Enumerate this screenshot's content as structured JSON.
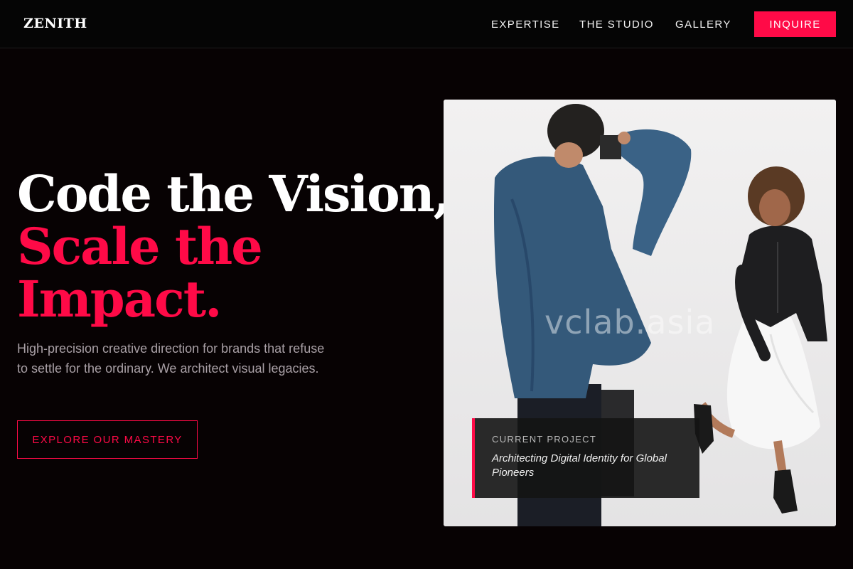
{
  "header": {
    "logo": "ZENITH",
    "nav": [
      {
        "label": "EXPERTISE"
      },
      {
        "label": "THE STUDIO"
      },
      {
        "label": "GALLERY"
      }
    ],
    "cta_label": "INQUIRE"
  },
  "hero": {
    "headline_line1": "Code the Vision,",
    "headline_line2": "Scale the Impact.",
    "subtitle": "High-precision creative direction for brands that refuse to settle for the ordinary. We architect visual legacies.",
    "cta_label": "EXPLORE OUR MASTERY"
  },
  "image": {
    "watermark": "vclab.asia",
    "project_label": "CURRENT PROJECT",
    "project_title": "Architecting Digital Identity for Global Pioneers"
  },
  "colors": {
    "accent": "#ff0a47",
    "background": "#070203",
    "header_background": "#050505",
    "muted_text": "#a9a0a6"
  }
}
